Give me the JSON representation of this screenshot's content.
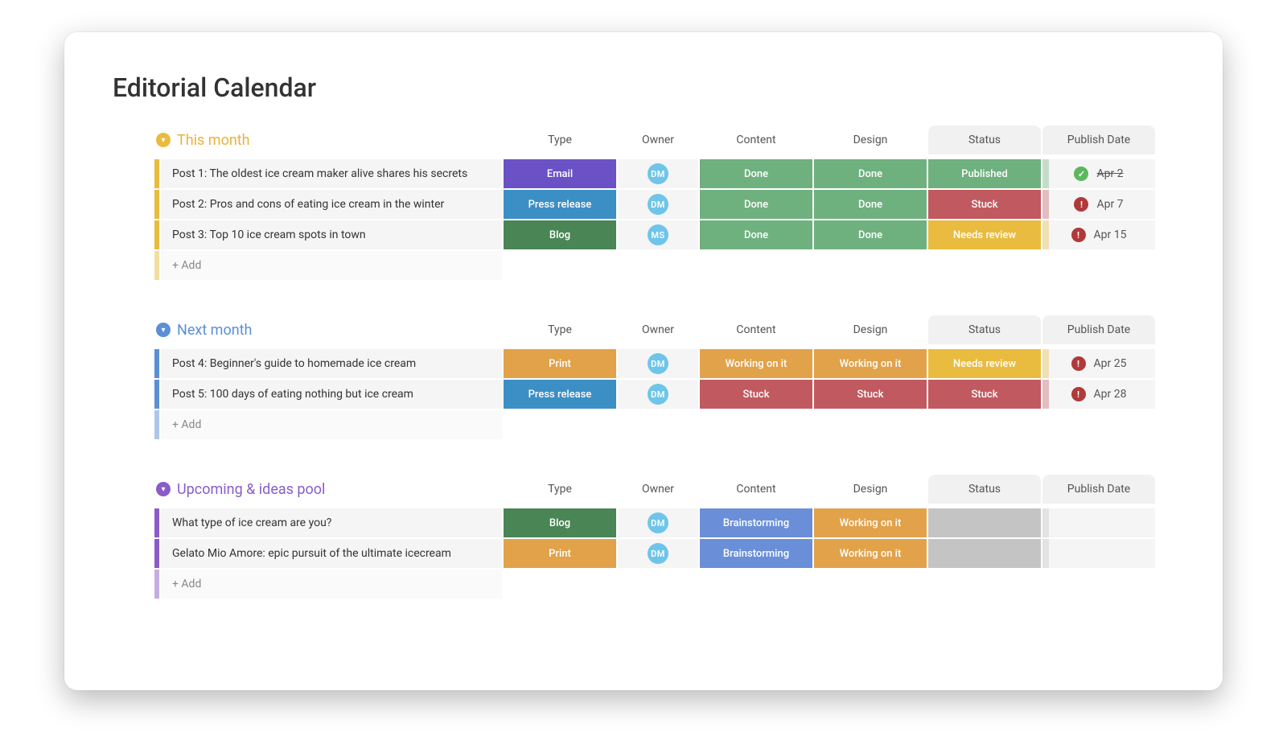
{
  "page_title": "Editorial Calendar",
  "columns": {
    "type": "Type",
    "owner": "Owner",
    "content": "Content",
    "design": "Design",
    "status": "Status",
    "publish_date": "Publish Date"
  },
  "add_label": "+ Add",
  "type_colors": {
    "Email": "c-purple",
    "Press release": "c-blue",
    "Blog": "c-dgreen",
    "Print": "c-orange"
  },
  "stage_colors": {
    "Done": "c-green",
    "Working on it": "c-orange",
    "Stuck": "c-red",
    "Brainstorming": "c-lblue"
  },
  "status_colors": {
    "Published": "c-green",
    "Stuck": "c-red",
    "Needs review": "c-yellow",
    "": "c-grey"
  },
  "groups": [
    {
      "id": "this-month",
      "title": "This month",
      "accent": "#e9bb3f",
      "title_color": "#e9b23a",
      "rows": [
        {
          "title": "Post 1: The oldest ice cream maker alive shares his secrets",
          "type": "Email",
          "owner": "DM",
          "content": "Done",
          "design": "Done",
          "status": "Published",
          "date": "Apr 2",
          "date_state": "done"
        },
        {
          "title": "Post 2: Pros and cons of eating ice cream in the winter",
          "type": "Press release",
          "owner": "DM",
          "content": "Done",
          "design": "Done",
          "status": "Stuck",
          "date": "Apr 7",
          "date_state": "overdue"
        },
        {
          "title": "Post 3: Top 10 ice cream spots in town",
          "type": "Blog",
          "owner": "MS",
          "content": "Done",
          "design": "Done",
          "status": "Needs review",
          "date": "Apr 15",
          "date_state": "overdue"
        }
      ]
    },
    {
      "id": "next-month",
      "title": "Next month",
      "accent": "#5b8fd6",
      "title_color": "#5b8fd6",
      "rows": [
        {
          "title": "Post 4: Beginner's guide to homemade ice cream",
          "type": "Print",
          "owner": "DM",
          "content": "Working on it",
          "design": "Working on it",
          "status": "Needs review",
          "date": "Apr 25",
          "date_state": "overdue"
        },
        {
          "title": "Post 5: 100 days of eating nothing but ice cream",
          "type": "Press release",
          "owner": "DM",
          "content": "Stuck",
          "design": "Stuck",
          "status": "Stuck",
          "date": "Apr 28",
          "date_state": "overdue"
        }
      ]
    },
    {
      "id": "upcoming",
      "title": "Upcoming & ideas pool",
      "accent": "#8b5cc7",
      "title_color": "#8b5cc7",
      "rows": [
        {
          "title": "What type of ice cream are you?",
          "type": "Blog",
          "owner": "DM",
          "content": "Brainstorming",
          "design": "Working on it",
          "status": "",
          "date": "",
          "date_state": "none"
        },
        {
          "title": "Gelato Mio Amore: epic pursuit of the ultimate icecream",
          "type": "Print",
          "owner": "DM",
          "content": "Brainstorming",
          "design": "Working on it",
          "status": "",
          "date": "",
          "date_state": "none"
        }
      ]
    }
  ]
}
